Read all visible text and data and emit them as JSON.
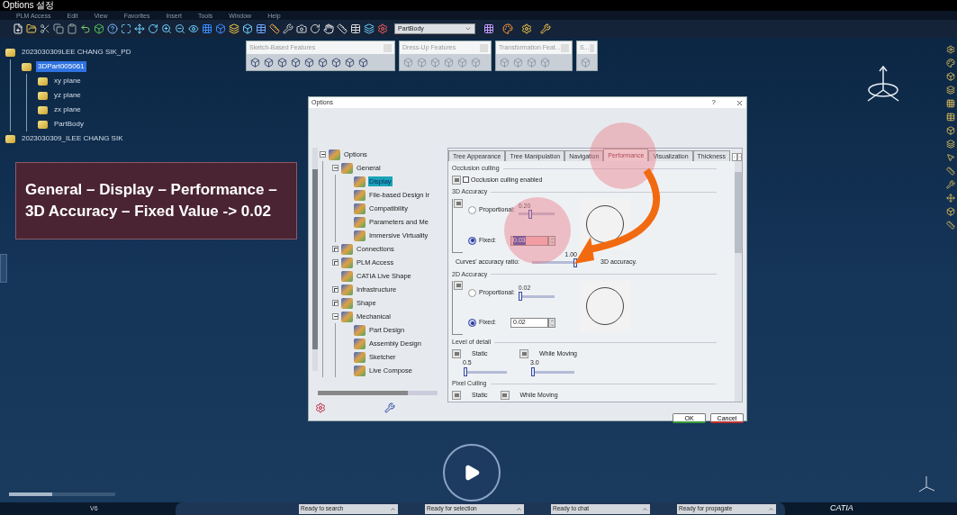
{
  "window": {
    "title": "Options 설정"
  },
  "menu": [
    "PLM Access",
    "Edit",
    "View",
    "Favorites",
    "Insert",
    "Tools",
    "Window",
    "Help"
  ],
  "toolbar": {
    "body_dropdown": "PartBody"
  },
  "model_tree": [
    {
      "label": "2023030309LEE CHANG SIK_PD",
      "selected": false,
      "children": [
        {
          "label": "3DPart005061",
          "selected": true,
          "children": [
            {
              "label": "xy plane",
              "selected": false
            },
            {
              "label": "yz plane",
              "selected": false
            },
            {
              "label": "zx plane",
              "selected": false
            },
            {
              "label": "PartBody",
              "selected": false
            }
          ]
        }
      ]
    },
    {
      "label": "2023030309_ILEE CHANG SIK",
      "selected": false
    }
  ],
  "floating_toolbars": [
    {
      "title": "Sketch-Based Features"
    },
    {
      "title": "Dress-Up Features"
    },
    {
      "title": "Transformation Feat..."
    },
    {
      "title": "S..."
    }
  ],
  "annotation": "General – Display – Performance – 3D Accuracy – Fixed Value -> 0.02",
  "dialog": {
    "title": "Options",
    "help": "?",
    "tree": [
      {
        "label": "Options",
        "expanded": true,
        "selected": false,
        "children": [
          {
            "label": "General",
            "expanded": true,
            "selected": false,
            "children": [
              {
                "label": "Display",
                "selected": true
              },
              {
                "label": "File-based Design Ir",
                "selected": false
              },
              {
                "label": "Compatibility",
                "selected": false
              },
              {
                "label": "Parameters and Me",
                "selected": false
              },
              {
                "label": "Immersive Virtuality",
                "selected": false
              }
            ]
          },
          {
            "label": "Connections",
            "expanded": false,
            "selected": false
          },
          {
            "label": "PLM Access",
            "expanded": false,
            "selected": false
          },
          {
            "label": "CATIA Live Shape",
            "selected": false
          },
          {
            "label": "Infrastructure",
            "expanded": false,
            "selected": false
          },
          {
            "label": "Shape",
            "expanded": false,
            "selected": false
          },
          {
            "label": "Mechanical",
            "expanded": true,
            "selected": false,
            "children": [
              {
                "label": "Part Design",
                "selected": false
              },
              {
                "label": "Assembly Design",
                "selected": false
              },
              {
                "label": "Sketcher",
                "selected": false
              },
              {
                "label": "Live Compose",
                "selected": false
              }
            ]
          }
        ]
      }
    ],
    "tabs": [
      {
        "label": "Tree Appearance",
        "selected": false
      },
      {
        "label": "Tree Manipulation",
        "selected": false
      },
      {
        "label": "Navigation",
        "selected": false
      },
      {
        "label": "Performance",
        "selected": true
      },
      {
        "label": "Visualization",
        "selected": false
      },
      {
        "label": "Thickness",
        "selected": false
      }
    ],
    "occlusion": {
      "title": "Occlusion culling",
      "checkbox": {
        "label": "Occlusion culling enabled",
        "checked": false
      }
    },
    "accuracy_3d": {
      "title": "3D Accuracy",
      "proportional": {
        "label": "Proportional:",
        "selected": false,
        "reading": "0.20",
        "level": 0.3
      },
      "fixed": {
        "label": "Fixed:",
        "selected": true,
        "value": "0.03"
      },
      "curves": {
        "label": "Curves' accuracy ratio:",
        "reading": "1.00",
        "level": 1,
        "suffix": "3D accuracy."
      }
    },
    "accuracy_2d": {
      "title": "2D Accuracy",
      "proportional": {
        "label": "Proportional:",
        "selected": false,
        "reading": "0.02",
        "level": 0
      },
      "fixed": {
        "label": "Fixed:",
        "selected": true,
        "value": "0.02"
      }
    },
    "level_of_detail": {
      "title": "Level of detail",
      "static": {
        "label": "Static",
        "reading": "0.5",
        "level": 0
      },
      "moving": {
        "label": "While Moving",
        "reading": "3.0",
        "level": 0
      }
    },
    "pixel_culling": {
      "title": "Pixel Culling",
      "static": {
        "label": "Static"
      },
      "moving": {
        "label": "While Moving"
      }
    },
    "buttons": [
      "OK",
      "Cancel"
    ]
  },
  "status_bar": {
    "left": "V6",
    "fields": [
      "Ready to search",
      "Ready for selection",
      "Ready to chat",
      "Ready for propagate"
    ],
    "brand": "CATIA"
  }
}
